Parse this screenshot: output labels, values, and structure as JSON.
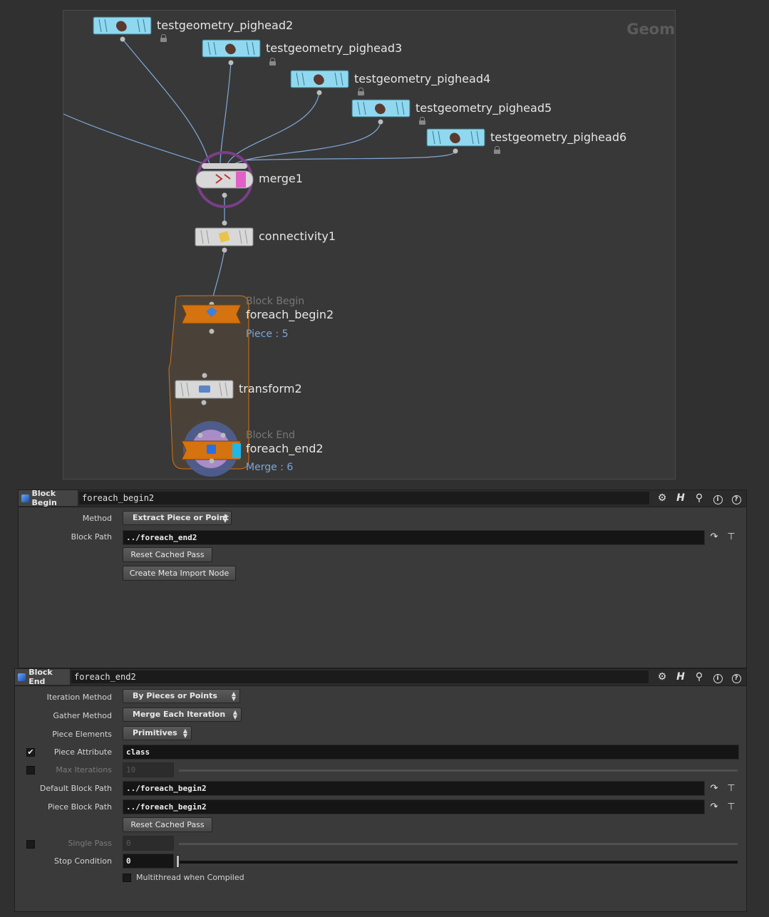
{
  "network": {
    "watermark": "Geom",
    "nodes": {
      "pighead2": "testgeometry_pighead2",
      "pighead3": "testgeometry_pighead3",
      "pighead4": "testgeometry_pighead4",
      "pighead5": "testgeometry_pighead5",
      "pighead6": "testgeometry_pighead6",
      "merge": "merge1",
      "connectivity": "connectivity1",
      "begin_type": "Block Begin",
      "begin": "foreach_begin2",
      "begin_info": "Piece : 5",
      "transform": "transform2",
      "end_type": "Block End",
      "end": "foreach_end2",
      "end_info": "Merge : 6"
    },
    "colors": {
      "geometry_node": "#8fd8f0",
      "block_node": "#d4730f",
      "merge_ring": "#7a3f8a",
      "info_text": "#7aa7de"
    }
  },
  "begin_pane": {
    "type_label": "Block Begin",
    "node_name": "foreach_begin2",
    "icons": [
      "gear-icon",
      "help-h-icon",
      "search-icon",
      "info-icon",
      "question-icon"
    ],
    "params": {
      "method_label": "Method",
      "method_value": "Extract Piece or Point",
      "block_path_label": "Block Path",
      "block_path_value": "../foreach_end2",
      "reset_cached_pass": "Reset Cached Pass",
      "create_meta_import": "Create Meta Import Node"
    }
  },
  "end_pane": {
    "type_label": "Block End",
    "node_name": "foreach_end2",
    "icons": [
      "gear-icon",
      "help-h-icon",
      "search-icon",
      "info-icon",
      "question-icon"
    ],
    "params": {
      "iteration_method_label": "Iteration Method",
      "iteration_method_value": "By Pieces or Points",
      "gather_method_label": "Gather Method",
      "gather_method_value": "Merge Each Iteration",
      "piece_elements_label": "Piece Elements",
      "piece_elements_value": "Primitives",
      "piece_attribute_label": "Piece Attribute",
      "piece_attribute_value": "class",
      "piece_attribute_enabled": true,
      "max_iterations_label": "Max Iterations",
      "max_iterations_value": "10",
      "max_iterations_enabled": false,
      "default_block_path_label": "Default Block Path",
      "default_block_path_value": "../foreach_begin2",
      "piece_block_path_label": "Piece Block Path",
      "piece_block_path_value": "../foreach_begin2",
      "reset_cached_pass": "Reset Cached Pass",
      "single_pass_label": "Single Pass",
      "single_pass_value": "0",
      "single_pass_enabled": false,
      "stop_condition_label": "Stop Condition",
      "stop_condition_value": "0",
      "multithread_label": "Multithread when Compiled",
      "multithread_enabled": false
    }
  }
}
